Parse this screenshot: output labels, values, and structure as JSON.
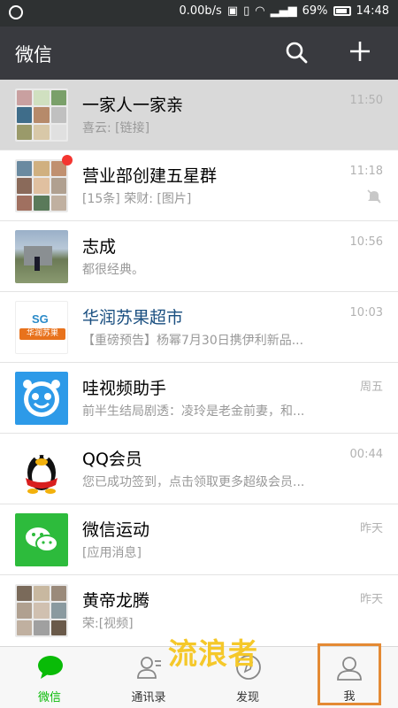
{
  "status_bar": {
    "speed": "0.00b/s",
    "battery": "69%",
    "time": "14:48"
  },
  "header": {
    "title": "微信",
    "search_icon": "search-icon",
    "add_icon": "plus-icon"
  },
  "chats": [
    {
      "name": "一家人一家亲",
      "preview": "喜云: [链接]",
      "time": "11:50"
    },
    {
      "name": "营业部创建五星群",
      "preview": "[15条]  荣财: [图片]",
      "time": "11:18",
      "muted": true,
      "unread_dot": true
    },
    {
      "name": "志成",
      "preview": "都很经典。",
      "time": "10:56"
    },
    {
      "name": "华润苏果超市",
      "preview": "【重磅预告】杨幂7月30日携伊利新品...",
      "time": "10:03",
      "logo_text": "华润苏果"
    },
    {
      "name": "哇视频助手",
      "preview": "前半生结局剧透：凌玲是老金前妻，和...",
      "time": "周五"
    },
    {
      "name": "QQ会员",
      "preview": "您已成功签到，点击领取更多超级会员...",
      "time": "00:44"
    },
    {
      "name": "微信运动",
      "preview": "[应用消息]",
      "time": "昨天"
    },
    {
      "name": "黄帝龙腾",
      "preview": "荣:[视频]",
      "time": "昨天"
    }
  ],
  "tabs": [
    {
      "label": "微信",
      "icon": "chat-bubble-icon",
      "active": true
    },
    {
      "label": "通讯录",
      "icon": "contacts-icon",
      "active": false
    },
    {
      "label": "发现",
      "icon": "compass-icon",
      "active": false
    },
    {
      "label": "我",
      "icon": "person-icon",
      "active": false
    }
  ],
  "watermark": "流浪者",
  "colors": {
    "accent": "#09bb07",
    "header_bg": "#393a3f",
    "status_bg": "#2e3132",
    "highlight_box": "#e48a34"
  }
}
